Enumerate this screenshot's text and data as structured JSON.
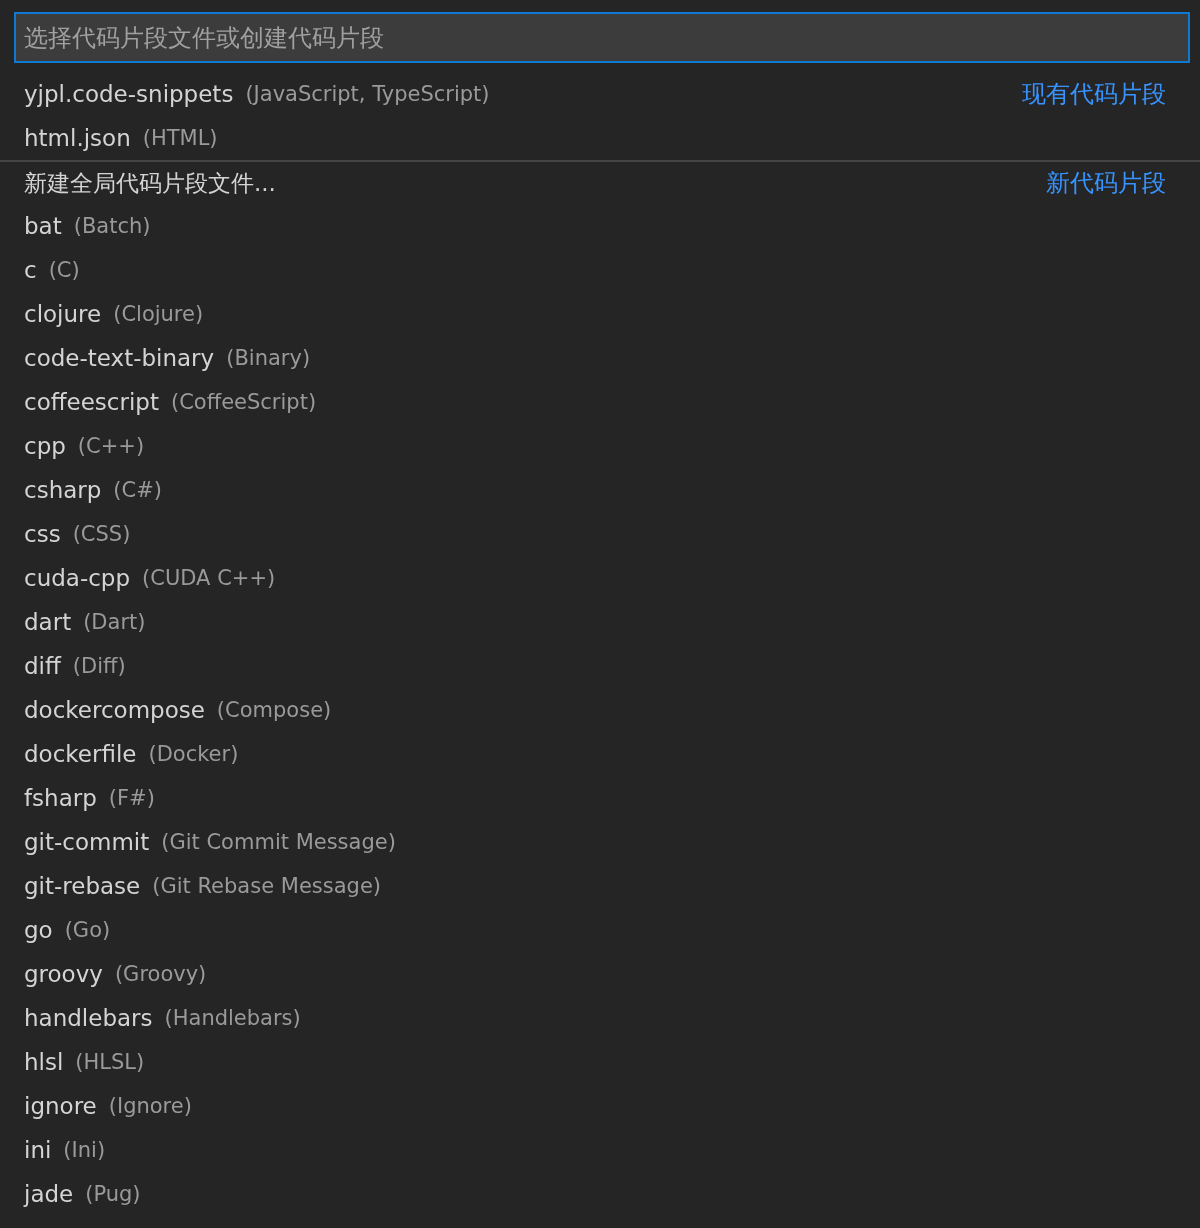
{
  "search": {
    "placeholder": "选择代码片段文件或创建代码片段"
  },
  "groups": [
    {
      "label": "现有代码片段",
      "items": [
        {
          "name": "yjpl.code-snippets",
          "description": "(JavaScript, TypeScript)"
        },
        {
          "name": "html.json",
          "description": "(HTML)"
        }
      ]
    },
    {
      "label": "新代码片段",
      "items": [
        {
          "name": "新建全局代码片段文件..."
        },
        {
          "name": "bat",
          "description": "(Batch)"
        },
        {
          "name": "c",
          "description": "(C)"
        },
        {
          "name": "clojure",
          "description": "(Clojure)"
        },
        {
          "name": "code-text-binary",
          "description": "(Binary)"
        },
        {
          "name": "coffeescript",
          "description": "(CoffeeScript)"
        },
        {
          "name": "cpp",
          "description": "(C++)"
        },
        {
          "name": "csharp",
          "description": "(C#)"
        },
        {
          "name": "css",
          "description": "(CSS)"
        },
        {
          "name": "cuda-cpp",
          "description": "(CUDA C++)"
        },
        {
          "name": "dart",
          "description": "(Dart)"
        },
        {
          "name": "diff",
          "description": "(Diff)"
        },
        {
          "name": "dockercompose",
          "description": "(Compose)"
        },
        {
          "name": "dockerfile",
          "description": "(Docker)"
        },
        {
          "name": "fsharp",
          "description": "(F#)"
        },
        {
          "name": "git-commit",
          "description": "(Git Commit Message)"
        },
        {
          "name": "git-rebase",
          "description": "(Git Rebase Message)"
        },
        {
          "name": "go",
          "description": "(Go)"
        },
        {
          "name": "groovy",
          "description": "(Groovy)"
        },
        {
          "name": "handlebars",
          "description": "(Handlebars)"
        },
        {
          "name": "hlsl",
          "description": "(HLSL)"
        },
        {
          "name": "ignore",
          "description": "(Ignore)"
        },
        {
          "name": "ini",
          "description": "(Ini)"
        },
        {
          "name": "jade",
          "description": "(Pug)"
        }
      ]
    }
  ]
}
